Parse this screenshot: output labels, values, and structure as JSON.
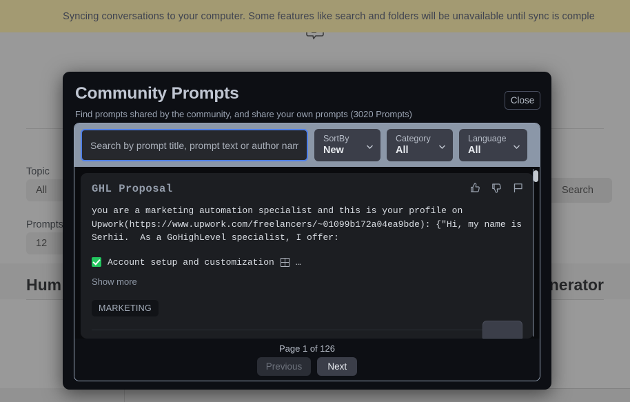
{
  "banner": {
    "text": "Syncing conversations to your computer. Some features like search and folders will be unavailable until sync is comple"
  },
  "background": {
    "chat_icon": "chat-bubble-icon",
    "topic_label": "Topic",
    "topic_value": "All",
    "prompts_label": "Prompts",
    "prompts_value": "12",
    "search_button": "Search",
    "card_title_left": "Hum",
    "card_title_right": "nerator"
  },
  "modal": {
    "title": "Community Prompts",
    "subtitle": "Find prompts shared by the community, and share your own prompts (3020 Prompts)",
    "close_label": "Close",
    "filters": {
      "search_placeholder": "Search by prompt title, prompt text or author name",
      "search_value": "",
      "sortby": {
        "label": "SortBy",
        "value": "New"
      },
      "category": {
        "label": "Category",
        "value": "All"
      },
      "language": {
        "label": "Language",
        "value": "All"
      }
    },
    "cards": [
      {
        "title": "GHL Proposal",
        "body": "you are a marketing automation specialist and this is your profile on Upwork(https://www.upwork.com/freelancers/~01099b172a04ea9bde): {\"Hi, my name is Serhii.  As a GoHighLevel specialist, I offer:",
        "bullet": "Account setup and customization",
        "show_more": "Show more",
        "tags": [
          "MARKETING"
        ],
        "actions": [
          "thumbs-up-icon",
          "thumbs-down-icon",
          "flag-icon"
        ]
      }
    ],
    "pagination": {
      "info": "Page 1 of 126",
      "previous": "Previous",
      "next": "Next"
    }
  },
  "colors": {
    "banner_bg": "#a39a72",
    "modal_bg": "#0d0f14",
    "filter_bar_bg": "#8b97a8",
    "focus_border": "#4f7fe8",
    "check_green": "#22c55e"
  }
}
